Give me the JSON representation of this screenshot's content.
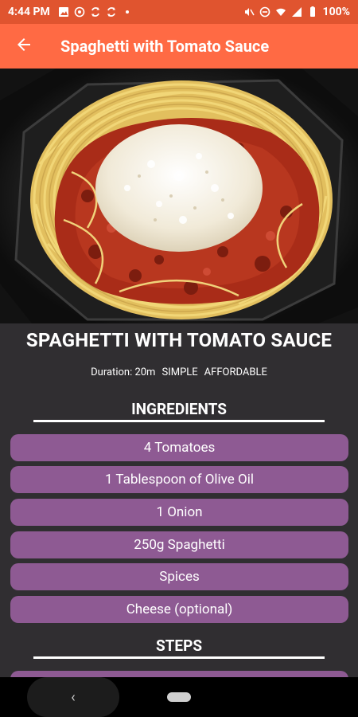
{
  "status_bar": {
    "time": "4:44 PM",
    "battery": "100%",
    "left_icons": [
      "image-icon",
      "cast-icon",
      "sync-icon",
      "sync-icon",
      "dot-icon"
    ],
    "right_icons": [
      "mute-icon",
      "dnd-icon",
      "wifi-icon",
      "signal-icon",
      "battery-icon"
    ]
  },
  "app_bar": {
    "title": "Spaghetti with Tomato Sauce",
    "back_icon": "arrow-back-icon",
    "color": "#ff6a44"
  },
  "recipe": {
    "title": "SPAGHETTI WITH TOMATO SAUCE",
    "duration": "Duration: 20m",
    "complexity": "SIMPLE",
    "affordability": "AFFORDABLE"
  },
  "ingredients": {
    "heading": "INGREDIENTS",
    "items": [
      "4 Tomatoes",
      "1 Tablespoon of Olive Oil",
      "1 Onion",
      "250g Spaghetti",
      "Spices",
      "Cheese (optional)"
    ]
  },
  "steps": {
    "heading": "STEPS"
  },
  "colors": {
    "background": "#302e31",
    "item": "#8e5a93",
    "status_bar": "#e0542f"
  },
  "nav_bar": {
    "back_glyph": "‹"
  }
}
